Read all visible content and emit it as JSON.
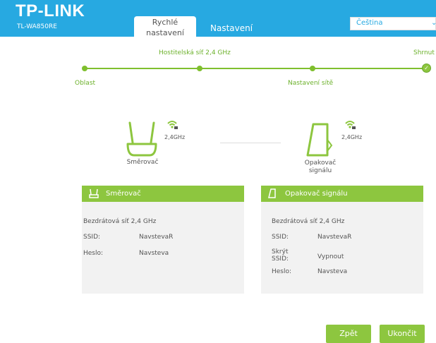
{
  "header": {
    "brand": "TP-LINK",
    "model": "TL-WA850RE",
    "tabs": [
      {
        "label_line1": "Rychlé",
        "label_line2": "nastavení"
      },
      {
        "label": "Nastavení"
      }
    ],
    "language": {
      "selected": "Čeština"
    }
  },
  "steps": {
    "labels": [
      "Oblast",
      "Hostitelská síť 2,4 GHz",
      "Nastavení sítě",
      "Shrnutí"
    ],
    "shown": [
      "Oblast",
      "Hostitelská síť 2,4 GHz",
      "Nastavení sítě",
      "Shrnut"
    ]
  },
  "devices": {
    "router_label": "Směrovač",
    "router_freq": "2,4GHz",
    "extender_label_line1": "Opakovač",
    "extender_label_line2": "signálu",
    "extender_freq": "2,4GHz"
  },
  "panels": {
    "router": {
      "title": "Směrovač",
      "section": "Bezdrátová síť 2,4 GHz",
      "ssid_label": "SSID:",
      "ssid_value": "NavstevaR",
      "password_label": "Heslo:",
      "password_value": "Navsteva"
    },
    "extender": {
      "title": "Opakovač signálu",
      "section": "Bezdrátová síť 2,4 GHz",
      "ssid_label": "SSID:",
      "ssid_value": "NavstevaR",
      "hide_ssid_label_line1": "Skrýt",
      "hide_ssid_label_line2": "SSID:",
      "hide_ssid_value": "Vypnout",
      "password_label": "Heslo:",
      "password_value": "Navsteva"
    }
  },
  "buttons": {
    "back": "Zpět",
    "finish": "Ukončit"
  },
  "colors": {
    "header": "#27a9e1",
    "accent": "#8dc63f",
    "text": "#555555"
  }
}
